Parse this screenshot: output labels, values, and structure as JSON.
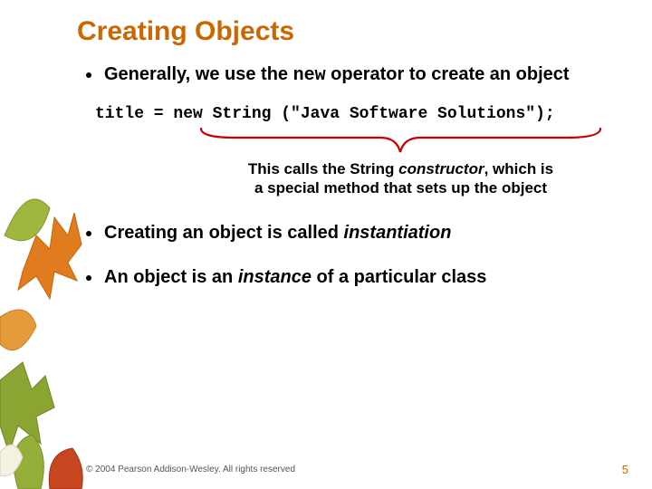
{
  "title": "Creating Objects",
  "bullets": {
    "b1_pre": "Generally, we use the ",
    "b1_code": "new",
    "b1_post": " operator to create an object",
    "b2_pre": "Creating an object is called ",
    "b2_em": "instantiation",
    "b3_pre": "An object is an ",
    "b3_em": "instance",
    "b3_post": " of a particular class"
  },
  "code": "title = new String (\"Java Software Solutions\");",
  "annotation": {
    "line1_pre": "This calls the String ",
    "line1_em": "constructor",
    "line1_post": ", which is",
    "line2": "a special method that sets up the object"
  },
  "footer": "© 2004 Pearson Addison-Wesley. All rights reserved",
  "pagenum": "5"
}
